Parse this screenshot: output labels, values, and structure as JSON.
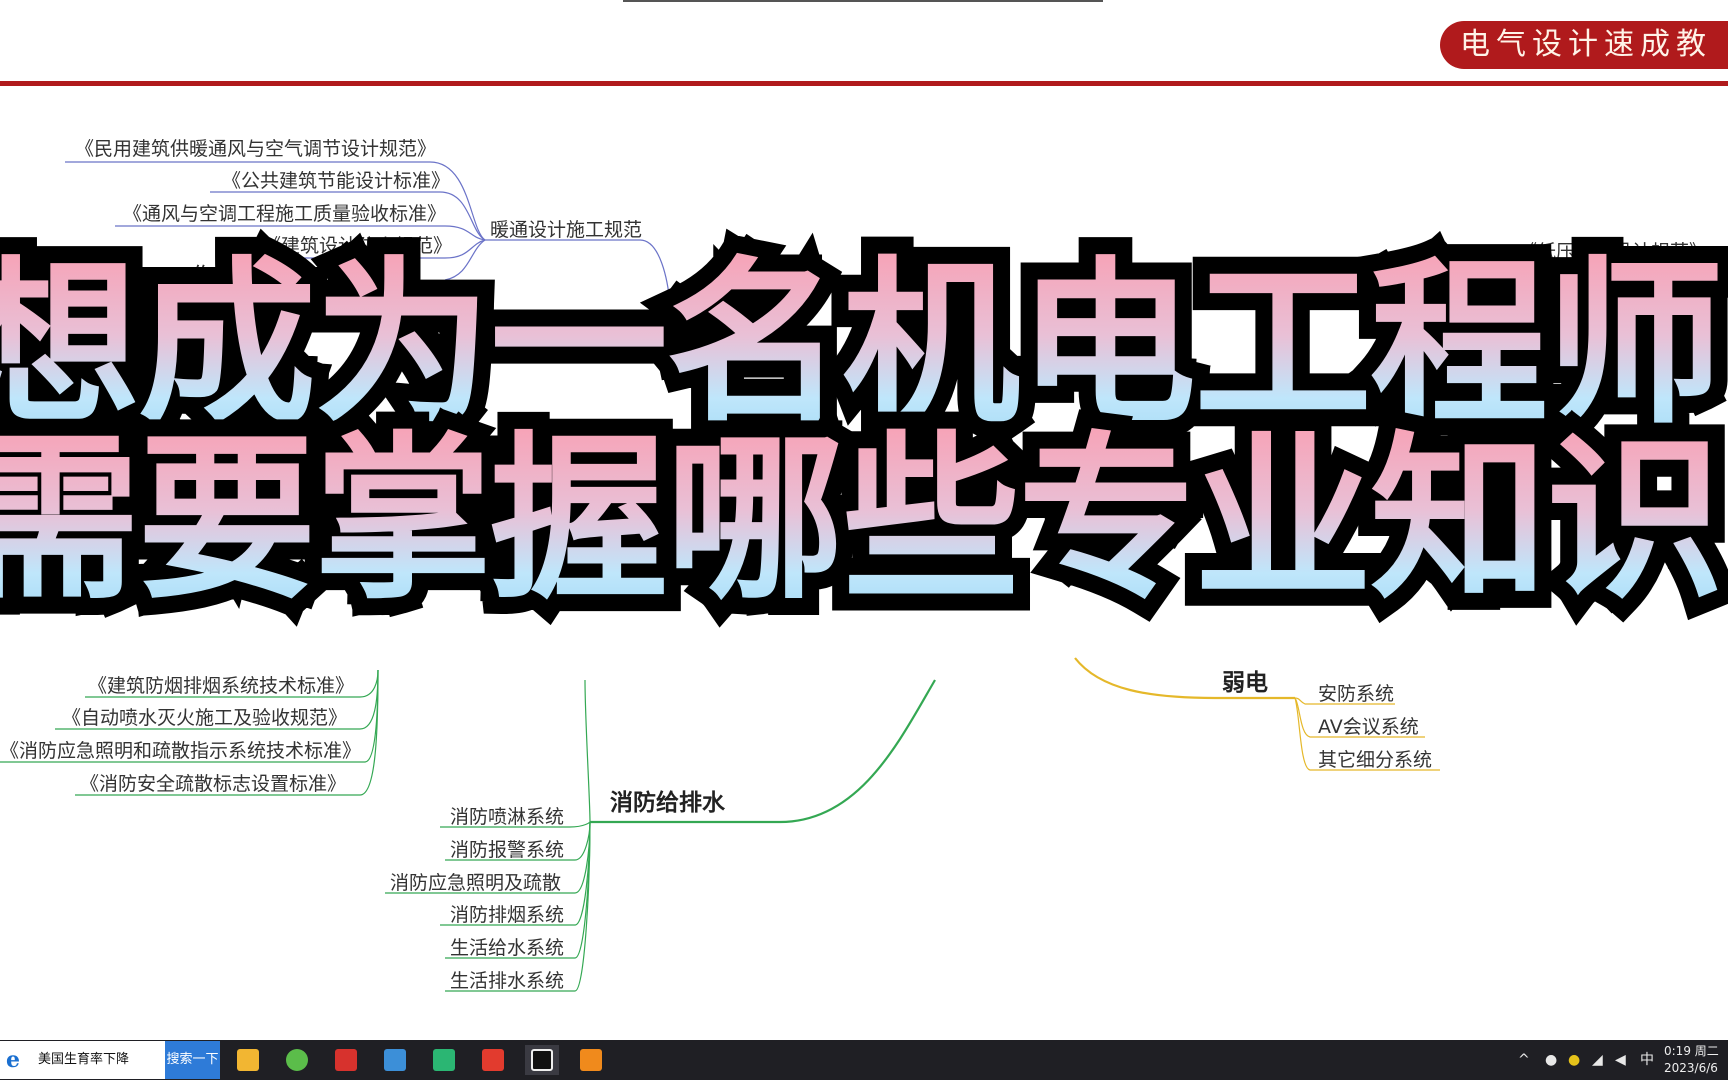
{
  "header": {
    "brand": "电气设计速成教"
  },
  "mindmap": {
    "hvac_branch": {
      "label": "暖通设计施工规范",
      "items": [
        "《民用建筑供暖通风与空气调节设计规范》",
        "《公共建筑节能设计标准》",
        "《通风与空调工程施工质量验收标准》",
        "《建筑设计防火规范》"
      ]
    },
    "partial_top_right": "《低压配电设计规范》",
    "fire_standards": [
      "《建筑防烟排烟系统技术标准》",
      "《自动喷水灭火施工及验收规范》",
      "《消防应急照明和疏散指示系统技术标准》",
      "《消防安全疏散标志设置标准》"
    ],
    "fire_water_branch": {
      "label": "消防给排水",
      "items": [
        "消防喷淋系统",
        "消防报警系统",
        "消防应急照明及疏散",
        "消防排烟系统",
        "生活给水系统",
        "生活排水系统"
      ]
    },
    "weak_current_branch": {
      "label": "弱电",
      "items": [
        "安防系统",
        "AV会议系统",
        "其它细分系统"
      ]
    },
    "colors": {
      "hvac_line": "#6b73c8",
      "fire_line": "#34a853",
      "weak_line": "#e5b82a",
      "accent_red": "#b01a1c"
    }
  },
  "overlay_title": {
    "line1": "想成为一名机电工程师",
    "line2": "需要掌握哪些专业知识"
  },
  "taskbar": {
    "search_text": "美国生育率下降",
    "search_button": "搜索一下",
    "apps": [
      {
        "name": "file-explorer-icon",
        "color": "#f2b632"
      },
      {
        "name": "browser-icon",
        "color": "#5bbd4a"
      },
      {
        "name": "autocad-icon",
        "color": "#d7322d"
      },
      {
        "name": "remote-desktop-icon",
        "color": "#3c8fd8"
      },
      {
        "name": "green-app-icon",
        "color": "#2bb673"
      },
      {
        "name": "wps-icon",
        "color": "#e23b2e"
      },
      {
        "name": "video-recorder-icon",
        "color": "#111111"
      },
      {
        "name": "player-icon",
        "color": "#f08a1c"
      }
    ],
    "ime": "中",
    "time": "0:19 周二",
    "date": "2023/6/6"
  }
}
